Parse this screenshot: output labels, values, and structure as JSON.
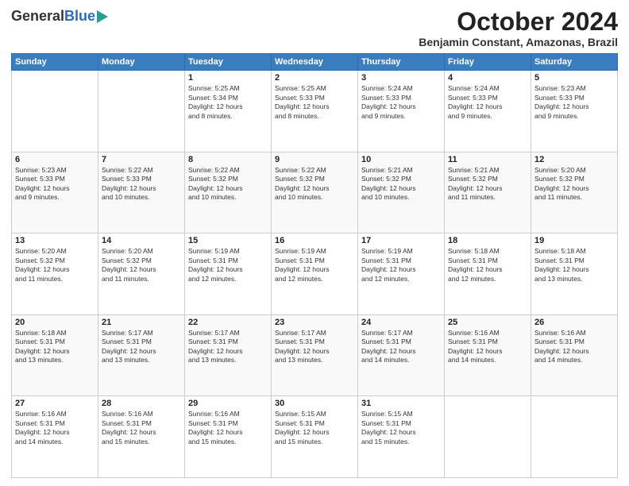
{
  "logo": {
    "general": "General",
    "blue": "Blue"
  },
  "header": {
    "title": "October 2024",
    "subtitle": "Benjamin Constant, Amazonas, Brazil"
  },
  "weekdays": [
    "Sunday",
    "Monday",
    "Tuesday",
    "Wednesday",
    "Thursday",
    "Friday",
    "Saturday"
  ],
  "weeks": [
    [
      {
        "day": "",
        "info": ""
      },
      {
        "day": "",
        "info": ""
      },
      {
        "day": "1",
        "info": "Sunrise: 5:25 AM\nSunset: 5:34 PM\nDaylight: 12 hours\nand 8 minutes."
      },
      {
        "day": "2",
        "info": "Sunrise: 5:25 AM\nSunset: 5:33 PM\nDaylight: 12 hours\nand 8 minutes."
      },
      {
        "day": "3",
        "info": "Sunrise: 5:24 AM\nSunset: 5:33 PM\nDaylight: 12 hours\nand 9 minutes."
      },
      {
        "day": "4",
        "info": "Sunrise: 5:24 AM\nSunset: 5:33 PM\nDaylight: 12 hours\nand 9 minutes."
      },
      {
        "day": "5",
        "info": "Sunrise: 5:23 AM\nSunset: 5:33 PM\nDaylight: 12 hours\nand 9 minutes."
      }
    ],
    [
      {
        "day": "6",
        "info": "Sunrise: 5:23 AM\nSunset: 5:33 PM\nDaylight: 12 hours\nand 9 minutes."
      },
      {
        "day": "7",
        "info": "Sunrise: 5:22 AM\nSunset: 5:33 PM\nDaylight: 12 hours\nand 10 minutes."
      },
      {
        "day": "8",
        "info": "Sunrise: 5:22 AM\nSunset: 5:32 PM\nDaylight: 12 hours\nand 10 minutes."
      },
      {
        "day": "9",
        "info": "Sunrise: 5:22 AM\nSunset: 5:32 PM\nDaylight: 12 hours\nand 10 minutes."
      },
      {
        "day": "10",
        "info": "Sunrise: 5:21 AM\nSunset: 5:32 PM\nDaylight: 12 hours\nand 10 minutes."
      },
      {
        "day": "11",
        "info": "Sunrise: 5:21 AM\nSunset: 5:32 PM\nDaylight: 12 hours\nand 11 minutes."
      },
      {
        "day": "12",
        "info": "Sunrise: 5:20 AM\nSunset: 5:32 PM\nDaylight: 12 hours\nand 11 minutes."
      }
    ],
    [
      {
        "day": "13",
        "info": "Sunrise: 5:20 AM\nSunset: 5:32 PM\nDaylight: 12 hours\nand 11 minutes."
      },
      {
        "day": "14",
        "info": "Sunrise: 5:20 AM\nSunset: 5:32 PM\nDaylight: 12 hours\nand 11 minutes."
      },
      {
        "day": "15",
        "info": "Sunrise: 5:19 AM\nSunset: 5:31 PM\nDaylight: 12 hours\nand 12 minutes."
      },
      {
        "day": "16",
        "info": "Sunrise: 5:19 AM\nSunset: 5:31 PM\nDaylight: 12 hours\nand 12 minutes."
      },
      {
        "day": "17",
        "info": "Sunrise: 5:19 AM\nSunset: 5:31 PM\nDaylight: 12 hours\nand 12 minutes."
      },
      {
        "day": "18",
        "info": "Sunrise: 5:18 AM\nSunset: 5:31 PM\nDaylight: 12 hours\nand 12 minutes."
      },
      {
        "day": "19",
        "info": "Sunrise: 5:18 AM\nSunset: 5:31 PM\nDaylight: 12 hours\nand 13 minutes."
      }
    ],
    [
      {
        "day": "20",
        "info": "Sunrise: 5:18 AM\nSunset: 5:31 PM\nDaylight: 12 hours\nand 13 minutes."
      },
      {
        "day": "21",
        "info": "Sunrise: 5:17 AM\nSunset: 5:31 PM\nDaylight: 12 hours\nand 13 minutes."
      },
      {
        "day": "22",
        "info": "Sunrise: 5:17 AM\nSunset: 5:31 PM\nDaylight: 12 hours\nand 13 minutes."
      },
      {
        "day": "23",
        "info": "Sunrise: 5:17 AM\nSunset: 5:31 PM\nDaylight: 12 hours\nand 13 minutes."
      },
      {
        "day": "24",
        "info": "Sunrise: 5:17 AM\nSunset: 5:31 PM\nDaylight: 12 hours\nand 14 minutes."
      },
      {
        "day": "25",
        "info": "Sunrise: 5:16 AM\nSunset: 5:31 PM\nDaylight: 12 hours\nand 14 minutes."
      },
      {
        "day": "26",
        "info": "Sunrise: 5:16 AM\nSunset: 5:31 PM\nDaylight: 12 hours\nand 14 minutes."
      }
    ],
    [
      {
        "day": "27",
        "info": "Sunrise: 5:16 AM\nSunset: 5:31 PM\nDaylight: 12 hours\nand 14 minutes."
      },
      {
        "day": "28",
        "info": "Sunrise: 5:16 AM\nSunset: 5:31 PM\nDaylight: 12 hours\nand 15 minutes."
      },
      {
        "day": "29",
        "info": "Sunrise: 5:16 AM\nSunset: 5:31 PM\nDaylight: 12 hours\nand 15 minutes."
      },
      {
        "day": "30",
        "info": "Sunrise: 5:15 AM\nSunset: 5:31 PM\nDaylight: 12 hours\nand 15 minutes."
      },
      {
        "day": "31",
        "info": "Sunrise: 5:15 AM\nSunset: 5:31 PM\nDaylight: 12 hours\nand 15 minutes."
      },
      {
        "day": "",
        "info": ""
      },
      {
        "day": "",
        "info": ""
      }
    ]
  ]
}
